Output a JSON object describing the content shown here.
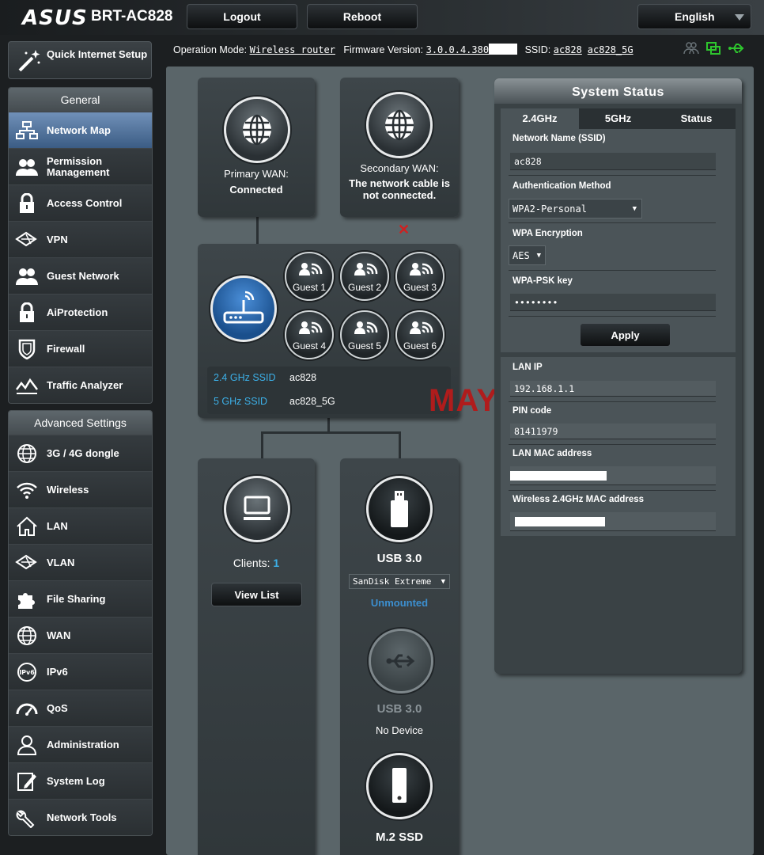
{
  "header": {
    "brand": "ASUS",
    "model": "BRT-AC828",
    "logout_label": "Logout",
    "reboot_label": "Reboot",
    "language": "English"
  },
  "status_line": {
    "operation_mode_label": "Operation Mode:",
    "operation_mode": "Wireless router",
    "firmware_label": "Firmware Version:",
    "firmware": "3.0.0.4.380",
    "ssid_label": "SSID:",
    "ssid_24": "ac828",
    "ssid_5": "ac828_5G"
  },
  "sidebar": {
    "quick_setup": "Quick Internet Setup",
    "general_title": "General",
    "general_items": [
      {
        "label": "Network Map",
        "icon": "network-map-icon"
      },
      {
        "label": "Permission Management",
        "icon": "users-icon"
      },
      {
        "label": "Access Control",
        "icon": "lock-icon"
      },
      {
        "label": "VPN",
        "icon": "vpn-icon"
      },
      {
        "label": "Guest Network",
        "icon": "guest-icon"
      },
      {
        "label": "AiProtection",
        "icon": "lock-icon"
      },
      {
        "label": "Firewall",
        "icon": "shield-icon"
      },
      {
        "label": "Traffic Analyzer",
        "icon": "traffic-icon"
      }
    ],
    "advanced_title": "Advanced Settings",
    "advanced_items": [
      {
        "label": "3G / 4G dongle",
        "icon": "globe-icon"
      },
      {
        "label": "Wireless",
        "icon": "wifi-icon"
      },
      {
        "label": "LAN",
        "icon": "home-icon"
      },
      {
        "label": "VLAN",
        "icon": "vlan-icon"
      },
      {
        "label": "File Sharing",
        "icon": "puzzle-icon"
      },
      {
        "label": "WAN",
        "icon": "globe-icon"
      },
      {
        "label": "IPv6",
        "icon": "ipv6-icon"
      },
      {
        "label": "QoS",
        "icon": "gauge-icon"
      },
      {
        "label": "Administration",
        "icon": "admin-icon"
      },
      {
        "label": "System Log",
        "icon": "log-icon"
      },
      {
        "label": "Network Tools",
        "icon": "tools-icon"
      }
    ]
  },
  "network_map": {
    "primary_wan_label": "Primary WAN:",
    "primary_wan_status": "Connected",
    "secondary_wan_label": "Secondary WAN:",
    "secondary_wan_status": "The network cable is not connected.",
    "guests": [
      "Guest 1",
      "Guest 2",
      "Guest 3",
      "Guest 4",
      "Guest 5",
      "Guest 6"
    ],
    "ssid24_label": "2.4 GHz SSID",
    "ssid24_value": "ac828",
    "ssid5_label": "5 GHz SSID",
    "ssid5_value": "ac828_5G",
    "clients_label": "Clients:",
    "clients_count": "1",
    "view_list": "View List",
    "usb1_label": "USB 3.0",
    "usb1_device": "SanDisk Extreme",
    "usb1_state": "Unmounted",
    "usb2_label": "USB 3.0",
    "usb2_state": "No Device",
    "m2_label": "M.2 SSD"
  },
  "system_status": {
    "title": "System Status",
    "tabs": [
      "2.4GHz",
      "5GHz",
      "Status"
    ],
    "ssid_label": "Network Name (SSID)",
    "ssid_value": "ac828",
    "auth_label": "Authentication Method",
    "auth_value": "WPA2-Personal",
    "enc_label": "WPA Encryption",
    "enc_value": "AES",
    "psk_label": "WPA-PSK key",
    "psk_value": "••••••••",
    "apply": "Apply",
    "lan_ip_label": "LAN IP",
    "lan_ip_value": "192.168.1.1",
    "pin_label": "PIN code",
    "pin_value": "81411979",
    "lan_mac_label": "LAN MAC address",
    "wl_mac_label": "Wireless 2.4GHz MAC address"
  },
  "watermark": "MAYLYN"
}
